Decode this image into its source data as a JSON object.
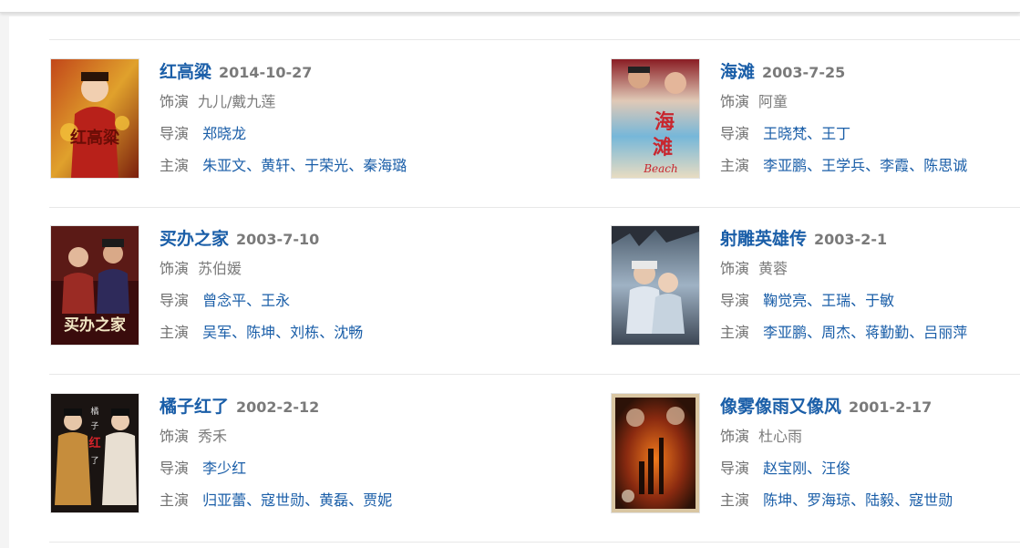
{
  "labels": {
    "role": "饰演",
    "director": "导演",
    "cast": "主演"
  },
  "colors": {
    "link": "#1a5ea8",
    "muted": "#7a7a7a",
    "divider": "#e8e8e8"
  },
  "movies": [
    {
      "title": "红高粱",
      "date": "2014-10-27",
      "role": "九儿/戴九莲",
      "directors": [
        "郑晓龙"
      ],
      "cast": [
        "朱亚文",
        "黄轩",
        "于荣光",
        "秦海璐"
      ],
      "poster_text": "红高粱"
    },
    {
      "title": "海滩",
      "date": "2003-7-25",
      "role": "阿童",
      "directors": [
        "王晓梵",
        "王丁"
      ],
      "cast": [
        "李亚鹏",
        "王学兵",
        "李霞",
        "陈思诚"
      ],
      "poster_text": "海滩 Beach"
    },
    {
      "title": "买办之家",
      "date": "2003-7-10",
      "role": "苏伯媛",
      "directors": [
        "曾念平",
        "王永"
      ],
      "cast": [
        "吴军",
        "陈坤",
        "刘栋",
        "沈畅"
      ],
      "poster_text": "买办之家"
    },
    {
      "title": "射雕英雄传",
      "date": "2003-2-1",
      "role": "黄蓉",
      "directors": [
        "鞠觉亮",
        "王瑞",
        "于敏"
      ],
      "cast": [
        "李亚鹏",
        "周杰",
        "蒋勤勤",
        "吕丽萍"
      ],
      "poster_text": ""
    },
    {
      "title": "橘子红了",
      "date": "2002-2-12",
      "role": "秀禾",
      "directors": [
        "李少红"
      ],
      "cast": [
        "归亚蕾",
        "寇世勋",
        "黄磊",
        "贾妮"
      ],
      "poster_text": "橘子红了"
    },
    {
      "title": "像雾像雨又像风",
      "date": "2001-2-17",
      "role": "杜心雨",
      "directors": [
        "赵宝刚",
        "汪俊"
      ],
      "cast": [
        "陈坤",
        "罗海琼",
        "陆毅",
        "寇世勋"
      ],
      "poster_text": ""
    }
  ]
}
